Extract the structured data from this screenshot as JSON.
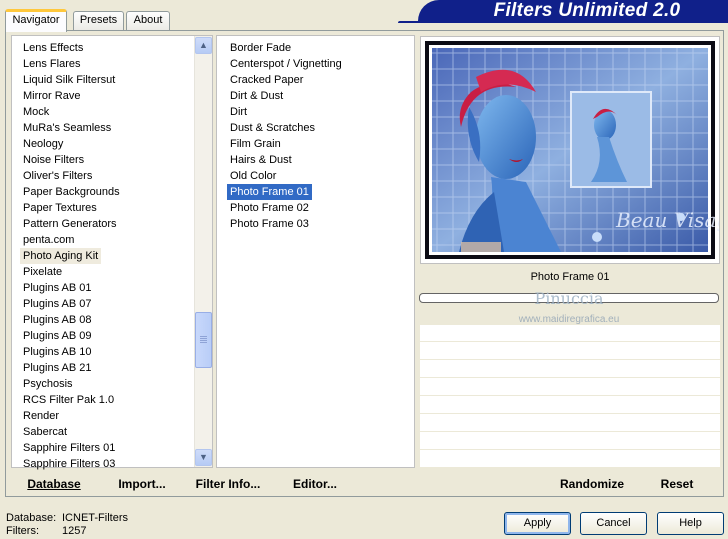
{
  "tabs": [
    {
      "label": "Navigator",
      "active": true
    },
    {
      "label": "Presets",
      "active": false
    },
    {
      "label": "About",
      "active": false
    }
  ],
  "title": "Filters Unlimited 2.0",
  "categories": [
    "Lens Effects",
    "Lens Flares",
    "Liquid Silk Filtersut",
    "Mirror Rave",
    "Mock",
    "MuRa's Seamless",
    "Neology",
    "Noise Filters",
    "Oliver's Filters",
    "Paper Backgrounds",
    "Paper Textures",
    "Pattern Generators",
    "penta.com",
    "Photo Aging Kit",
    "Pixelate",
    "Plugins AB 01",
    "Plugins AB 07",
    "Plugins AB 08",
    "Plugins AB 09",
    "Plugins AB 10",
    "Plugins AB 21",
    "Psychosis",
    "RCS Filter Pak 1.0",
    "Render",
    "Sabercat",
    "Sapphire Filters 01",
    "Sapphire Filters 03"
  ],
  "selected_category": "Photo Aging Kit",
  "filters": [
    "Border Fade",
    "Centerspot / Vignetting",
    "Cracked Paper",
    "Dirt & Dust",
    "Dirt",
    "Dust & Scratches",
    "Film Grain",
    "Hairs & Dust",
    "Old Color",
    "Photo Frame 01",
    "Photo Frame 02",
    "Photo Frame 03"
  ],
  "selected_filter": "Photo Frame 01",
  "preview": {
    "filter_name": "Photo Frame 01",
    "signature": "Beau Visage",
    "watermark": "Pinuccia",
    "watermark_url": "www.maidiregrafica.eu",
    "progress": 0
  },
  "bar_buttons": {
    "database": "Database",
    "import": "Import...",
    "filter_info": "Filter Info...",
    "editor": "Editor...",
    "randomize": "Randomize",
    "reset": "Reset"
  },
  "footer": {
    "database_label": "Database:",
    "database_value": "ICNET-Filters",
    "filters_label": "Filters:",
    "filters_value": "1257"
  },
  "buttons": {
    "apply": "Apply",
    "cancel": "Cancel",
    "help": "Help"
  },
  "colors": {
    "title_banner": "#10208a",
    "selection_blue": "#316ac5",
    "selection_gray": "#efebde",
    "tab_highlight": "#ffc83c"
  }
}
